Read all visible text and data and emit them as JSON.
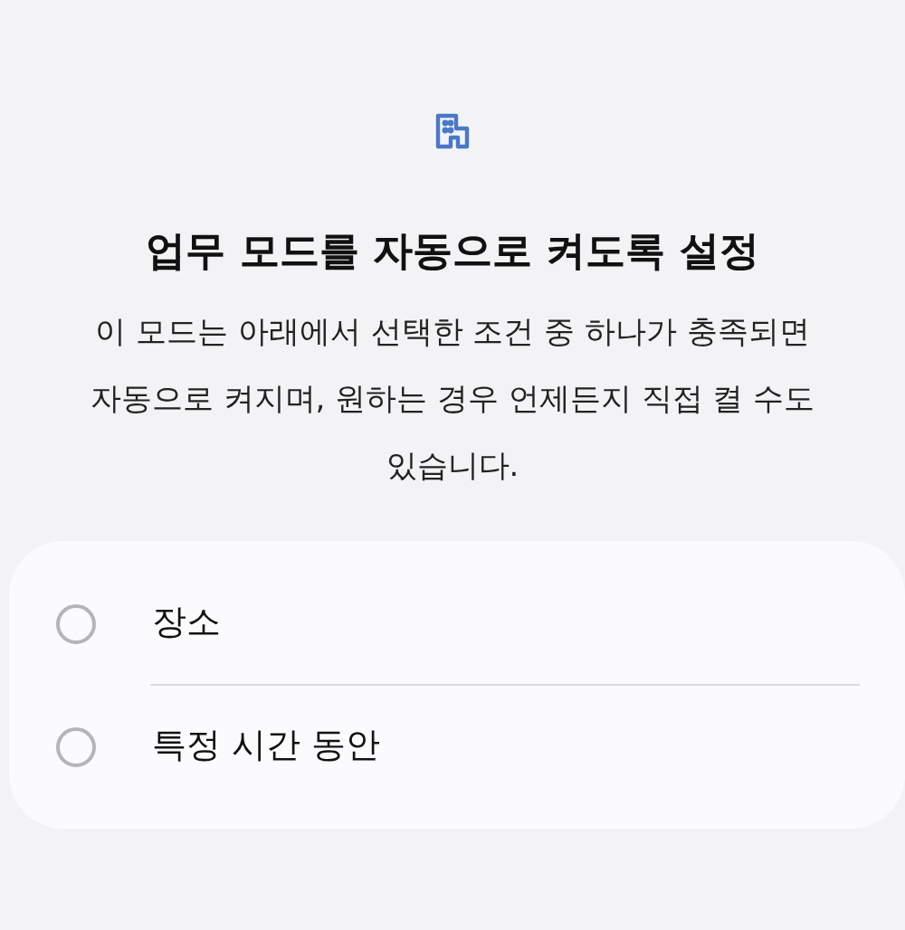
{
  "title": "업무 모드를 자동으로 켜도록 설정",
  "description": "이 모드는 아래에서 선택한 조건 중 하나가 충족되면 자동으로 켜지며, 원하는 경우 언제든지 직접 켤 수도 있습니다.",
  "options": [
    {
      "label": "장소",
      "selected": false
    },
    {
      "label": "특정 시간 동안",
      "selected": false
    }
  ]
}
